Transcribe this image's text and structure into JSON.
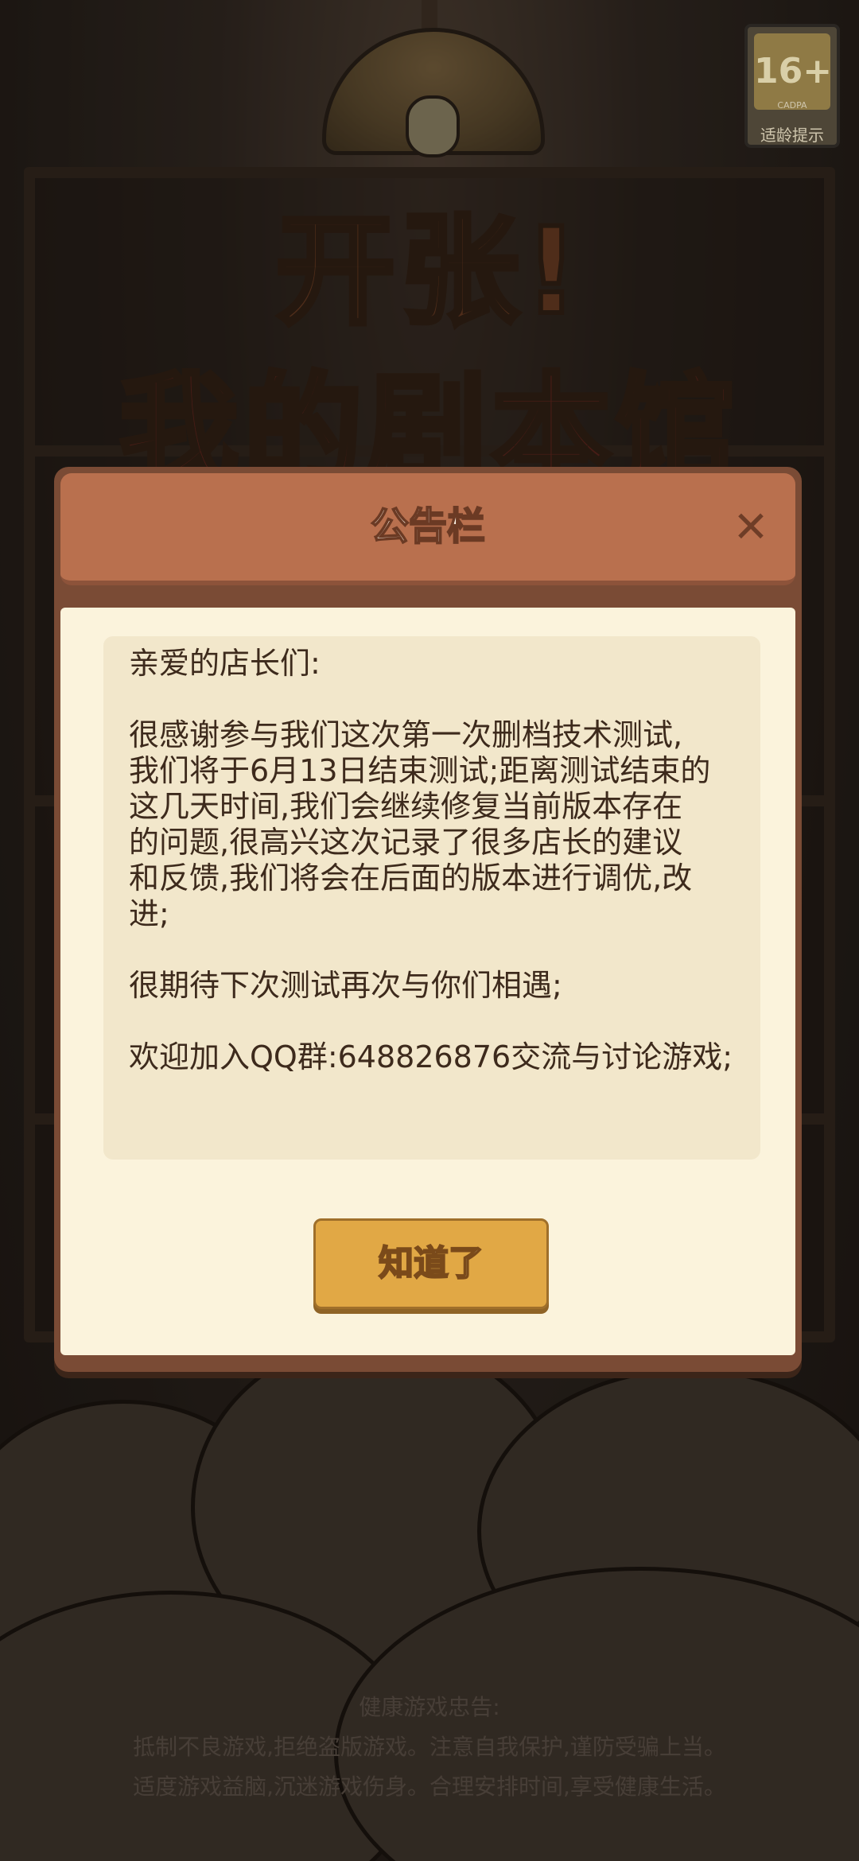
{
  "background": {
    "logo_line1": "开张!",
    "logo_line2": "我的剧本馆",
    "age_badge": {
      "rating": "16+",
      "org": "CADPA",
      "label": "适龄提示"
    },
    "health_advice": {
      "title": "健康游戏忠告:",
      "line1": "抵制不良游戏,拒绝盗版游戏。注意自我保护,谨防受骗上当。",
      "line2": "适度游戏益脑,沉迷游戏伤身。合理安排时间,享受健康生活。"
    }
  },
  "dialog": {
    "title": "公告栏",
    "close_icon": "close-icon",
    "message": {
      "greeting": "亲爱的店长们:",
      "para1_lines": [
        "很感谢参与我们这次第一次删档技术测试,",
        "我们将于6月13日结束测试;距离测试结束的",
        "这几天时间,我们会继续修复当前版本存在",
        "的问题,很高兴这次记录了很多店长的建议",
        "和反馈,我们将会在后面的版本进行调优,改",
        "进;"
      ],
      "para2": "很期待下次测试再次与你们相遇;",
      "para3": "欢迎加入QQ群:648826876交流与讨论游戏;"
    },
    "confirm_label": "知道了"
  },
  "colors": {
    "header": "#b9704e",
    "paper": "#fbf3dc",
    "button": "#e1a845",
    "text": "#3d2a1c"
  }
}
